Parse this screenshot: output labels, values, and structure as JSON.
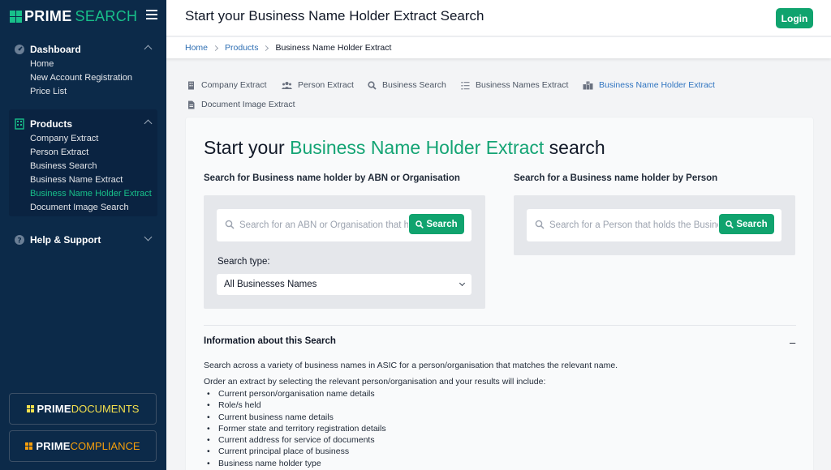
{
  "brand": {
    "bold": "PRIME",
    "light": "SEARCH",
    "colors": {
      "mark": "#18c08a",
      "accent": "#18c08a"
    }
  },
  "sidebar": {
    "groups": [
      {
        "label": "Dashboard",
        "icon": "dashboard-gauge-icon",
        "expanded": true,
        "items": [
          "Home",
          "New Account Registration",
          "Price List"
        ]
      },
      {
        "label": "Products",
        "icon": "products-building-icon",
        "expanded": true,
        "items": [
          "Company Extract",
          "Person Extract",
          "Business Search",
          "Business Name Extract",
          "Business Name Holder Extract",
          "Document Image Search"
        ],
        "active_item": "Business Name Holder Extract"
      },
      {
        "label": "Help & Support",
        "icon": "help-question-icon",
        "expanded": false,
        "items": []
      }
    ],
    "sister_sites": [
      {
        "bold": "PRIME",
        "light": "DOCUMENTS",
        "color": "#f4e04d"
      },
      {
        "bold": "PRIME",
        "light": "COMPLIANCE",
        "color": "#f59e0b"
      }
    ]
  },
  "header": {
    "title": "Start your Business Name Holder Extract Search",
    "login_label": "Login"
  },
  "breadcrumb": {
    "items": [
      "Home",
      "Products"
    ],
    "current": "Business Name Holder Extract"
  },
  "tabs": [
    {
      "label": "Company Extract",
      "icon": "building-icon"
    },
    {
      "label": "Person Extract",
      "icon": "people-icon"
    },
    {
      "label": "Business Search",
      "icon": "search-icon"
    },
    {
      "label": "Business Names Extract",
      "icon": "list-icon"
    },
    {
      "label": "Business Name Holder Extract",
      "icon": "city-icon",
      "active": true
    },
    {
      "label": "Document Image Extract",
      "icon": "document-icon"
    }
  ],
  "main": {
    "heading_prefix": "Start your ",
    "heading_highlight": "Business Name Holder Extract",
    "heading_suffix": " search",
    "left": {
      "title": "Search for Business name holder by ABN or Organisation",
      "placeholder": "Search for an ABN or Organisation that holds the Business name",
      "button": "Search",
      "search_type_label": "Search type:",
      "search_type_value": "All Businesses Names"
    },
    "right": {
      "title": "Search for a Business name holder by Person",
      "placeholder": "Search for a Person that holds the Business name",
      "button": "Search"
    },
    "info": {
      "title": "Information about this Search",
      "collapse_symbol": "–",
      "para1": "Search across a variety of business names in ASIC for a person/organisation that matches the relevant name.",
      "para2": "Order an extract by selecting the relevant person/organisation and your results will include:",
      "bullets": [
        "Current person/organisation name details",
        "Role/s held",
        "Current business name details",
        "Former state and territory registration details",
        "Current address for service of documents",
        "Current principal place of business",
        "Business name holder type"
      ]
    }
  }
}
